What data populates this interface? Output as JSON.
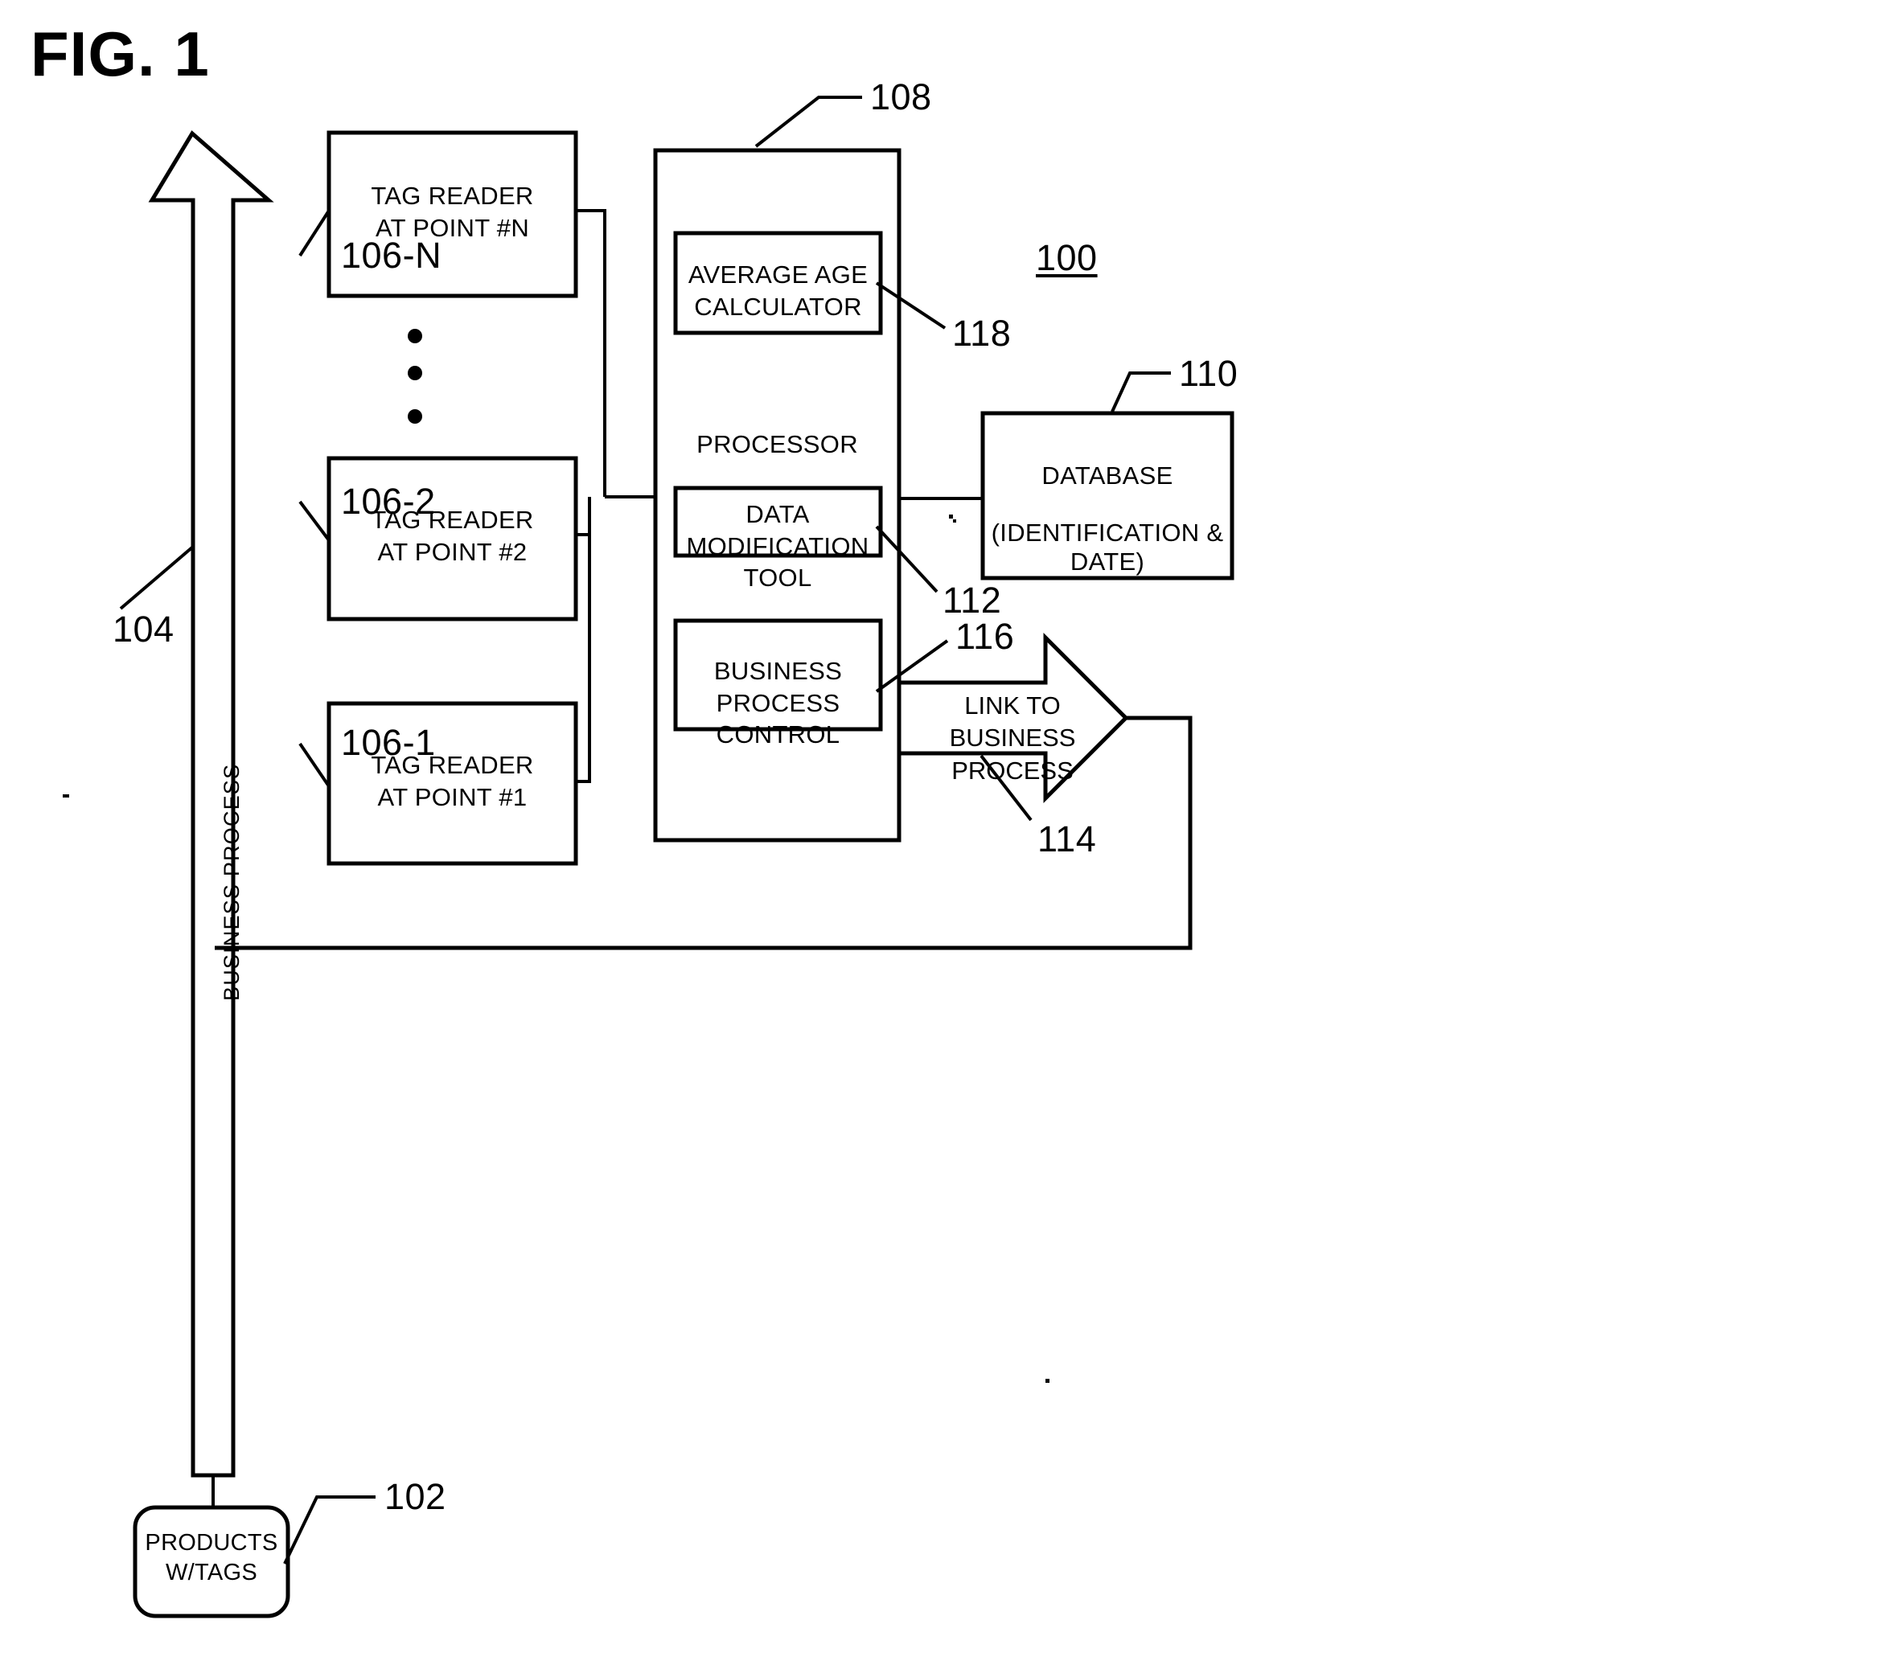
{
  "figure": {
    "title": "FIG. 1",
    "system_ref": "100"
  },
  "boxes": {
    "tag_reader_n": {
      "label": "TAG READER\nAT POINT #N",
      "ref": "106-N"
    },
    "tag_reader_2": {
      "label": "TAG READER\nAT POINT #2",
      "ref": "106-2"
    },
    "tag_reader_1": {
      "label": "TAG READER\nAT POINT #1",
      "ref": "106-1"
    },
    "processor": {
      "label": "PROCESSOR",
      "ref": "108"
    },
    "average_age_calculator": {
      "label": "AVERAGE AGE\nCALCULATOR",
      "ref": "118"
    },
    "data_modification_tool": {
      "label": "DATA MODIFICATION\nTOOL",
      "ref": "112"
    },
    "business_process_control": {
      "label": "BUSINESS PROCESS\nCONTROL",
      "ref": "116"
    },
    "database": {
      "label": "DATABASE\n\n(IDENTIFICATION & DATE)",
      "ref": "110"
    },
    "products_with_tags": {
      "label": "PRODUCTS\nW/TAGS",
      "ref": "102"
    }
  },
  "arrows": {
    "business_process": {
      "label": "BUSINESS PROCESS",
      "ref": "104"
    },
    "link_to_business_process": {
      "label": "LINK TO\nBUSINESS PROCESS",
      "ref": "114"
    }
  },
  "ellipsis": {
    "dots": "three-vertical-dots"
  },
  "colors": {
    "stroke": "#000000",
    "fill": "#ffffff",
    "text": "#000000"
  }
}
